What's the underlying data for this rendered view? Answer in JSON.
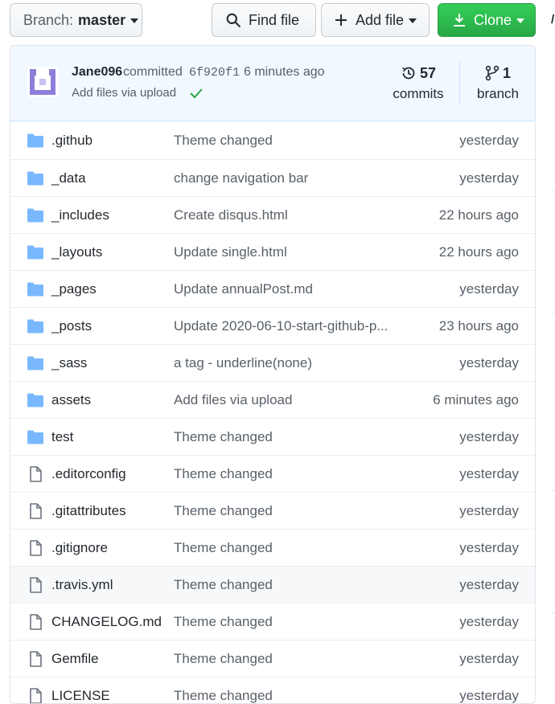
{
  "toolbar": {
    "branch_prefix": "Branch:",
    "branch_name": "master",
    "find_file": "Find file",
    "add_file": "Add file",
    "clone": "Clone",
    "accent_green": "#2ea44f"
  },
  "commit": {
    "author": "Jane096",
    "verb": "committed",
    "sha": "6f920f1",
    "time": "6 minutes ago",
    "message": "Add files via upload",
    "commits_count": "57",
    "commits_label": "commits",
    "branch_count": "1",
    "branch_label": "branch"
  },
  "files": [
    {
      "type": "folder",
      "name": ".github",
      "message": "Theme changed",
      "age": "yesterday"
    },
    {
      "type": "folder",
      "name": "_data",
      "message": "change navigation bar",
      "age": "yesterday"
    },
    {
      "type": "folder",
      "name": "_includes",
      "message": "Create disqus.html",
      "age": "22 hours ago"
    },
    {
      "type": "folder",
      "name": "_layouts",
      "message": "Update single.html",
      "age": "22 hours ago"
    },
    {
      "type": "folder",
      "name": "_pages",
      "message": "Update annualPost.md",
      "age": "yesterday"
    },
    {
      "type": "folder",
      "name": "_posts",
      "message": "Update 2020-06-10-start-github-p...",
      "age": "23 hours ago"
    },
    {
      "type": "folder",
      "name": "_sass",
      "message": "a tag - underline(none)",
      "age": "yesterday"
    },
    {
      "type": "folder",
      "name": "assets",
      "message": "Add files via upload",
      "age": "6 minutes ago"
    },
    {
      "type": "folder",
      "name": "test",
      "message": "Theme changed",
      "age": "yesterday"
    },
    {
      "type": "file",
      "name": ".editorconfig",
      "message": "Theme changed",
      "age": "yesterday"
    },
    {
      "type": "file",
      "name": ".gitattributes",
      "message": "Theme changed",
      "age": "yesterday"
    },
    {
      "type": "file",
      "name": ".gitignore",
      "message": "Theme changed",
      "age": "yesterday"
    },
    {
      "type": "file",
      "name": ".travis.yml",
      "message": "Theme changed",
      "age": "yesterday",
      "highlighted": true
    },
    {
      "type": "file",
      "name": "CHANGELOG.md",
      "message": "Theme changed",
      "age": "yesterday"
    },
    {
      "type": "file",
      "name": "Gemfile",
      "message": "Theme changed",
      "age": "yesterday"
    },
    {
      "type": "file",
      "name": "LICENSE",
      "message": "Theme changed",
      "age": "yesterday"
    }
  ],
  "colors": {
    "folder": "#79b8ff",
    "file_icon": "#6a737d",
    "commit_bar_bg": "#f1f8ff",
    "check": "#28a745",
    "avatar": "#8c7fd9"
  }
}
